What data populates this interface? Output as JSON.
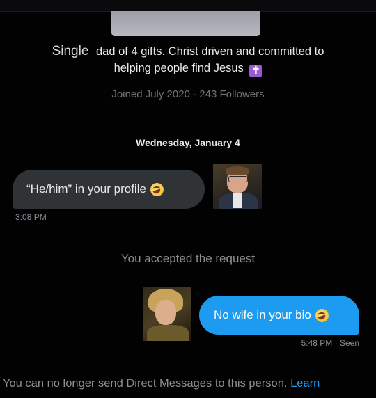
{
  "profile": {
    "bio_prefix": "Single",
    "bio_line1": "dad of 4 gifts. Christ driven and committed to",
    "bio_line2": "helping people find Jesus",
    "bio_emoji": "latin-cross-emoji",
    "meta": "Joined July 2020 · 243 Followers"
  },
  "conversation": {
    "date": "Wednesday, January 4",
    "messages": [
      {
        "direction": "incoming",
        "text": "“He/him” in your profile",
        "emoji": "rolling-on-floor-laughing-emoji",
        "time": "3:08 PM"
      },
      {
        "direction": "outgoing",
        "text": "No wife in your bio",
        "emoji": "rolling-on-floor-laughing-emoji",
        "time": "5:48 PM · Seen"
      }
    ],
    "system_note": "You accepted the request"
  },
  "footer": {
    "text": "You can no longer send Direct Messages to this person.",
    "link": "Learn"
  },
  "colors": {
    "background": "#020203",
    "incoming_bubble": "#2f3336",
    "outgoing_bubble": "#1d9bf0",
    "muted_text": "#8b8f94",
    "link": "#1d9bf0",
    "cross_badge": "#9b59d6"
  }
}
